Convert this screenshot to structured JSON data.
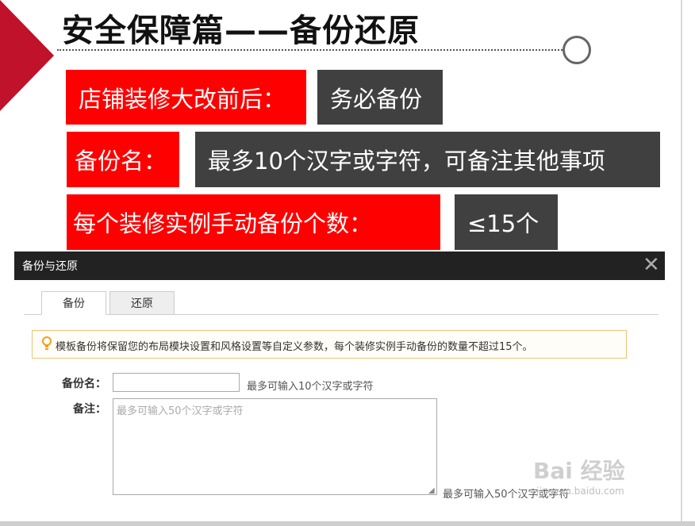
{
  "slide": {
    "title": "安全保障篇——备份还原",
    "rows": [
      {
        "label": "店铺装修大改前后：",
        "value": "务必备份"
      },
      {
        "label": "备份名：",
        "value": "最多10个汉字或字符，可备注其他事项"
      },
      {
        "label": "每个装修实例手动备份个数：",
        "value": "≤15个"
      }
    ],
    "colors": {
      "accent_red": "#ff0000",
      "triangle": "#c0122b",
      "dark_box": "#404040"
    }
  },
  "dialog": {
    "title": "备份与还原",
    "close_icon": "close-icon",
    "tabs": [
      {
        "label": "备份",
        "active": true
      },
      {
        "label": "还原",
        "active": false
      }
    ],
    "notice": {
      "icon": "lightbulb-icon",
      "text": "模板备份将保留您的布局模块设置和风格设置等自定义参数，每个装修实例手动备份的数量不超过15个。"
    },
    "form": {
      "name_label": "备份名：",
      "name_value": "",
      "name_hint": "最多可输入10个汉字或字符",
      "note_label": "备注：",
      "note_placeholder": "最多可输入50个汉字或字符",
      "note_hint": "最多可输入50个汉字或字符"
    }
  },
  "watermark": {
    "brand": "Bai 经验",
    "url": "jingyan.baidu.com"
  }
}
